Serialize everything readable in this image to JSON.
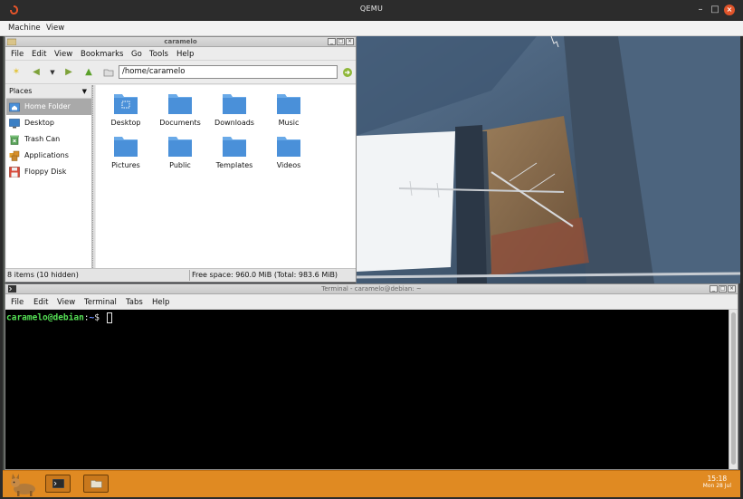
{
  "host": {
    "title": "QEMU",
    "menu": [
      "Machine",
      "View"
    ],
    "controls": {
      "minimize": "–",
      "maximize": "□",
      "close": "×"
    }
  },
  "file_manager": {
    "title": "caramelo",
    "menu": [
      "File",
      "Edit",
      "View",
      "Bookmarks",
      "Go",
      "Tools",
      "Help"
    ],
    "path": "/home/caramelo",
    "places_label": "Places",
    "places": [
      {
        "label": "Home Folder",
        "icon": "home-folder-icon",
        "selected": true
      },
      {
        "label": "Desktop",
        "icon": "desktop-icon",
        "selected": false
      },
      {
        "label": "Trash Can",
        "icon": "trash-icon",
        "selected": false
      },
      {
        "label": "Applications",
        "icon": "applications-icon",
        "selected": false
      },
      {
        "label": "Floppy Disk",
        "icon": "floppy-icon",
        "selected": false
      }
    ],
    "files": [
      {
        "label": "Desktop"
      },
      {
        "label": "Documents"
      },
      {
        "label": "Downloads"
      },
      {
        "label": "Music"
      },
      {
        "label": "Pictures"
      },
      {
        "label": "Public"
      },
      {
        "label": "Templates"
      },
      {
        "label": "Videos"
      }
    ],
    "status_items": "8 items (10 hidden)",
    "status_space": "Free space: 960.0 MiB (Total: 983.6 MiB)"
  },
  "terminal": {
    "title": "Terminal - caramelo@debian: ~",
    "menu": [
      "File",
      "Edit",
      "View",
      "Terminal",
      "Tabs",
      "Help"
    ],
    "prompt_user": "caramelo@debian",
    "prompt_sep": ":",
    "prompt_path": "~",
    "prompt_symbol": "$"
  },
  "taskbar": {
    "time": "15:18",
    "date": "Mon 28 Jul"
  },
  "colors": {
    "taskbar": "#e08a22",
    "folder": "#4a90d9",
    "prompt_user": "#55e055",
    "prompt_path": "#6b8cff"
  }
}
